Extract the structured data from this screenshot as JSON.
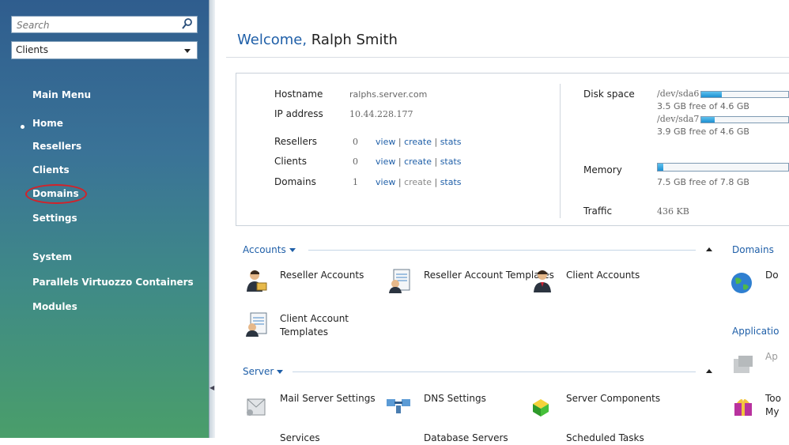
{
  "sidebar": {
    "search_placeholder": "Search",
    "scope_select": "Clients",
    "main_menu_heading": "Main Menu",
    "main_items": [
      "Home",
      "Resellers",
      "Clients",
      "Domains",
      "Settings"
    ],
    "system_heading": "System",
    "system_items": [
      "Parallels Virtuozzo Containers",
      "Modules"
    ]
  },
  "header": {
    "welcome_prefix": "Welcome,",
    "user_name": "Ralph Smith"
  },
  "info": {
    "hostname_label": "Hostname",
    "hostname_value": "ralphs.server.com",
    "ip_label": "IP address",
    "ip_value": "10.44.228.177",
    "counts": [
      {
        "label": "Resellers",
        "value": "0",
        "view": "view",
        "create": "create",
        "stats": "stats"
      },
      {
        "label": "Clients",
        "value": "0",
        "view": "view",
        "create": "create",
        "stats": "stats"
      },
      {
        "label": "Domains",
        "value": "1",
        "view": "view",
        "create": "create",
        "stats": "stats"
      }
    ],
    "separator": "|",
    "disk_label": "Disk space",
    "disks": [
      {
        "device": "/dev/sda6",
        "free_text": "3.5 GB free of 4.6 GB",
        "used_fraction": 0.24
      },
      {
        "device": "/dev/sda7",
        "free_text": "3.9 GB free of 4.6 GB",
        "used_fraction": 0.15
      }
    ],
    "memory_label": "Memory",
    "memory_free_text": "7.5 GB free of 7.8 GB",
    "memory_used_fraction": 0.04,
    "traffic_label": "Traffic",
    "traffic_value": "436 KB"
  },
  "sections": {
    "accounts_title": "Accounts",
    "accounts_items": [
      "Reseller Accounts",
      "Reseller Account Templates",
      "Client Accounts",
      "Client Account Templates"
    ],
    "domains_title": "Domains",
    "domains_item": "Do",
    "applications_title": "Applicatio",
    "applications_item": "Ap",
    "server_title": "Server",
    "server_items": [
      "Mail Server Settings",
      "DNS Settings",
      "Server Components"
    ],
    "tools_item": "Too My",
    "bottom_partial": [
      "Services",
      "Database Servers",
      "Scheduled Tasks"
    ]
  },
  "colors": {
    "link": "#1f5fa8",
    "highlight": "#d2222a"
  }
}
